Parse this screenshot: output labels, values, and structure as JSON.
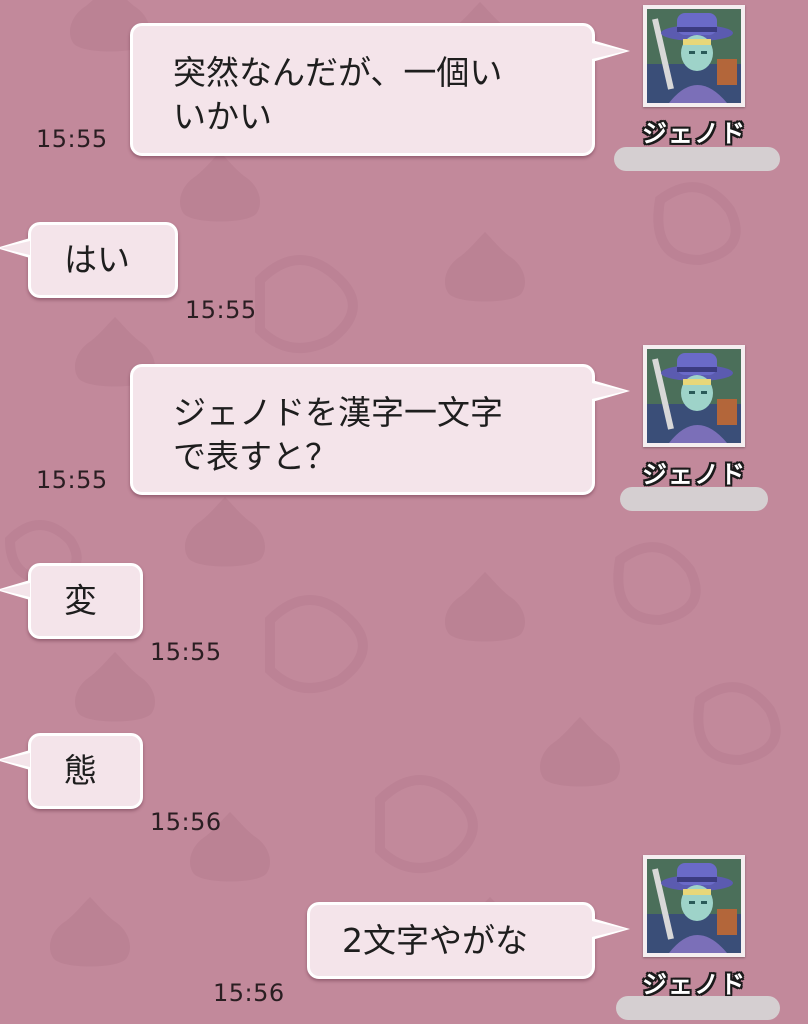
{
  "sender_name": "ジェノド",
  "avatar_icon": "character-avatar-icon",
  "colors": {
    "background": "#c2899b",
    "bubble": "#f4e4ea",
    "bubble_border": "#ffffff"
  },
  "messages": [
    {
      "side": "right",
      "lines": [
        "突然なんだが、一個い",
        "いかい"
      ],
      "time": "15:55"
    },
    {
      "side": "left",
      "lines": [
        "はい"
      ],
      "time": "15:55"
    },
    {
      "side": "right",
      "lines": [
        "ジェノドを漢字一文字",
        "で表すと？"
      ],
      "time": "15:55"
    },
    {
      "side": "left",
      "lines": [
        "変"
      ],
      "time": "15:55"
    },
    {
      "side": "left",
      "lines": [
        "態"
      ],
      "time": "15:56"
    },
    {
      "side": "right",
      "lines": [
        "2文字やがな"
      ],
      "time": "15:56"
    }
  ]
}
